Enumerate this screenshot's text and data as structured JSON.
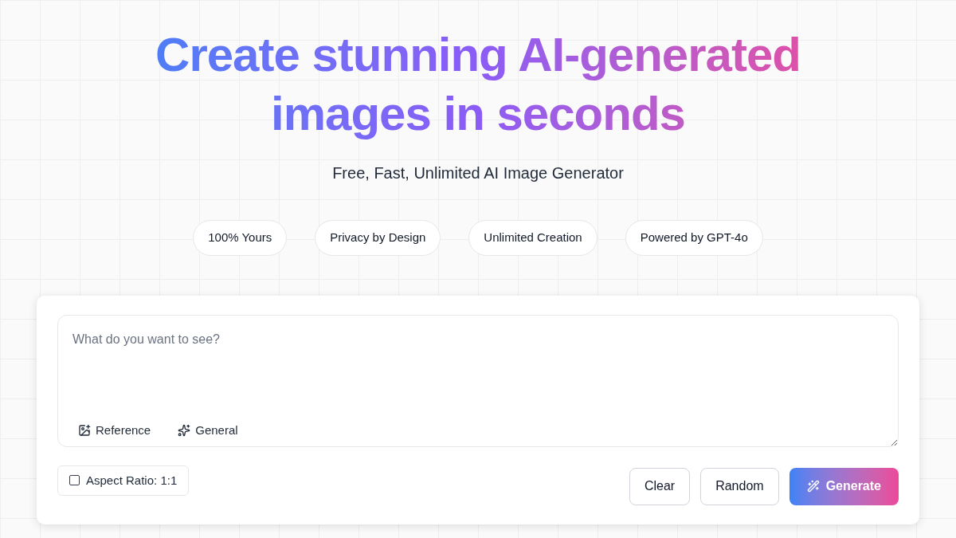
{
  "hero": {
    "title": "Create stunning AI-generated images in seconds",
    "subtitle": "Free, Fast, Unlimited AI Image Generator"
  },
  "features": [
    "100% Yours",
    "Privacy by Design",
    "Unlimited Creation",
    "Powered by GPT-4o"
  ],
  "prompt": {
    "placeholder": "What do you want to see?",
    "tools": [
      {
        "kind": "image",
        "label": "Reference"
      },
      {
        "kind": "sparkle",
        "label": "General"
      }
    ]
  },
  "aspect_ratio": {
    "label": "Aspect Ratio: 1:1",
    "checked": false
  },
  "actions": [
    {
      "kind": "plain",
      "label": "Clear"
    },
    {
      "kind": "plain",
      "label": "Random"
    },
    {
      "kind": "primary",
      "label": "Generate"
    }
  ]
}
